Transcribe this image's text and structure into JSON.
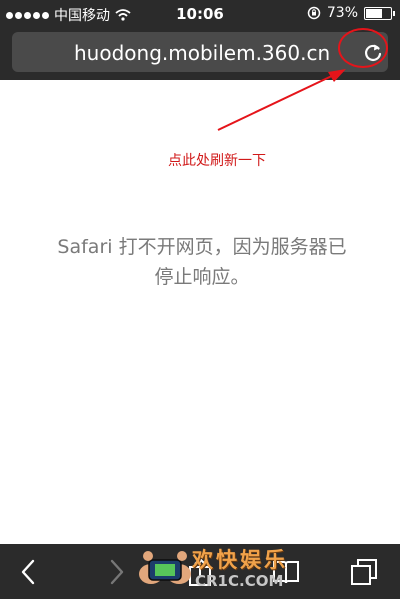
{
  "status_bar": {
    "carrier": "中国移动",
    "time": "10:06",
    "battery_percent": "73%",
    "battery_level": 0.73,
    "icons": [
      "signal-dots-icon",
      "wifi-icon",
      "rotation-lock-icon",
      "battery-icon"
    ]
  },
  "address_bar": {
    "url": "huodong.mobilem.360.cn",
    "reload_icon": "reload-icon"
  },
  "annotation": {
    "text": "点此处刷新一下",
    "color": "#d11a1a"
  },
  "error": {
    "message": "Safari 打不开网页，因为服务器已停止响应。"
  },
  "toolbar": {
    "icons": [
      "back-icon",
      "forward-icon",
      "share-icon",
      "bookmarks-icon",
      "tabs-icon"
    ]
  },
  "watermark": {
    "text": "欢快娱乐",
    "site": "CR1C.COM"
  },
  "colors": {
    "bar_background": "#2b2b2b",
    "url_field": "#4a4a4a",
    "highlight": "#e5141a"
  }
}
